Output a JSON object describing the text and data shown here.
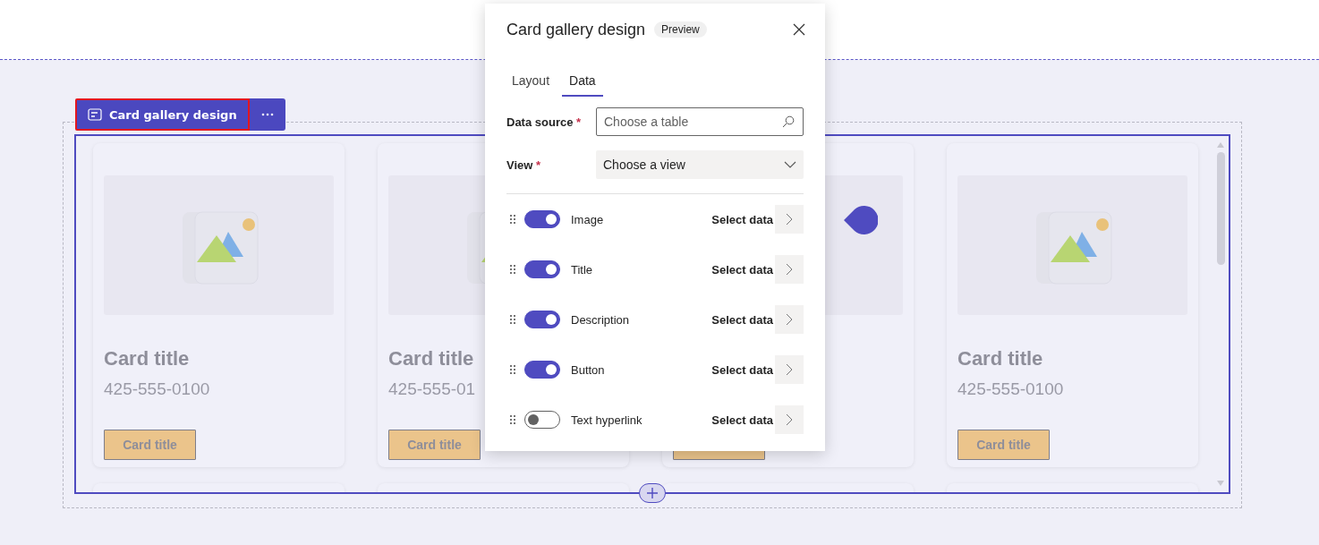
{
  "toolbar": {
    "title": "Card gallery design",
    "selected": true
  },
  "cards": [
    {
      "title": "Card title",
      "phone": "425-555-0100",
      "button": "Card title"
    },
    {
      "title": "Card title",
      "phone": "425-555-01",
      "button": "Card title"
    },
    {
      "kind": "covered"
    },
    {
      "title": "Card title",
      "phone": "425-555-0100",
      "button": "Card title"
    }
  ],
  "dialog": {
    "title": "Card gallery design",
    "badge": "Preview",
    "tabs": [
      {
        "label": "Layout",
        "selected": false
      },
      {
        "label": "Data",
        "selected": true
      }
    ],
    "fields": [
      {
        "kind": "search",
        "label": "Data source",
        "required_mark": "*",
        "placeholder": "Choose a table"
      },
      {
        "kind": "dropdown",
        "label": "View",
        "required_mark": "*",
        "value": "Choose a view"
      }
    ],
    "rows": [
      {
        "label": "Image",
        "on": true,
        "action": "Select data"
      },
      {
        "label": "Title",
        "on": true,
        "action": "Select data"
      },
      {
        "label": "Description",
        "on": true,
        "action": "Select data"
      },
      {
        "label": "Button",
        "on": true,
        "action": "Select data"
      },
      {
        "label": "Text hyperlink",
        "on": false,
        "action": "Select data"
      }
    ]
  }
}
